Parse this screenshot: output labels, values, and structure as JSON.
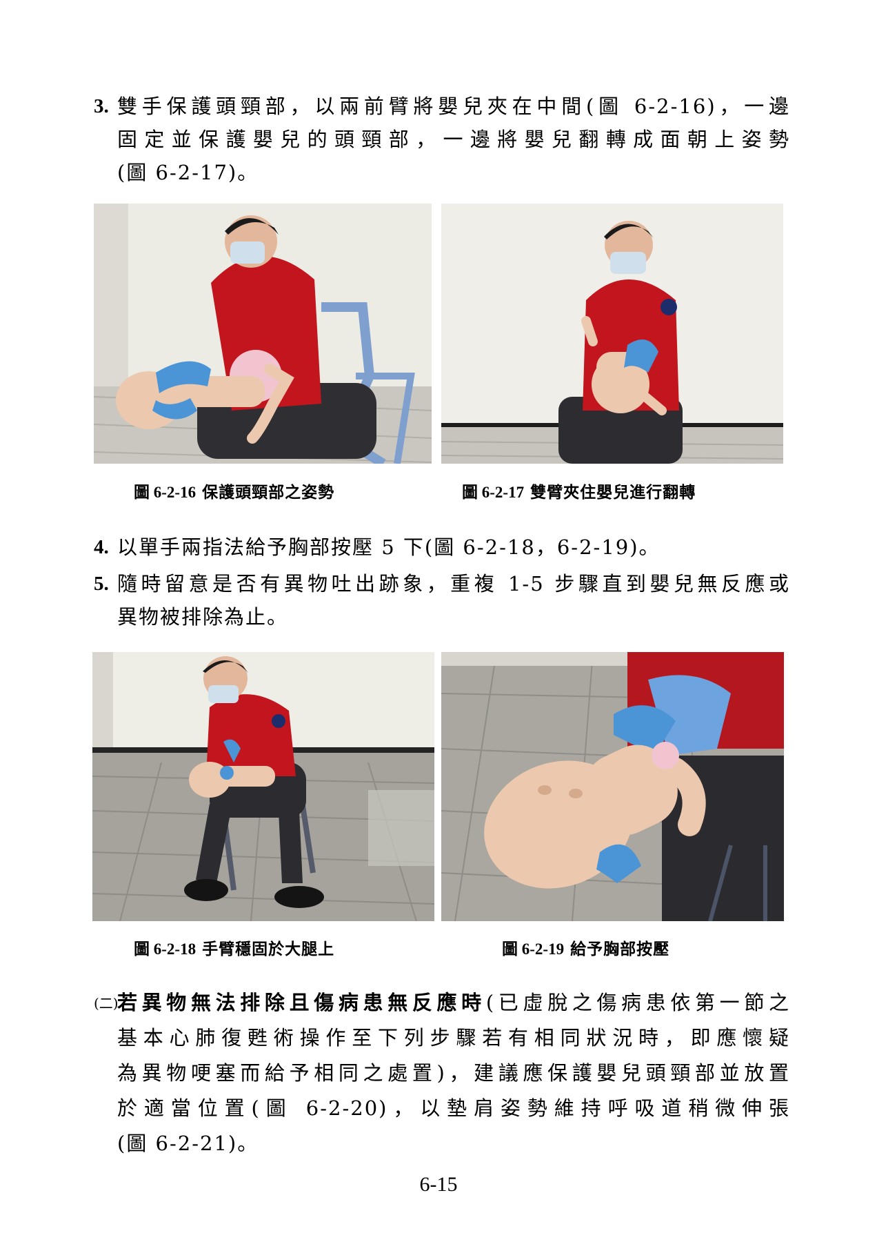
{
  "step3": {
    "num": "3.",
    "lines": [
      "雙手保護頭頸部，以兩前臂將嬰兒夾在中間(圖 6-2-16)，一邊",
      "固定並保護嬰兒的頭頸部，一邊將嬰兒翻轉成面朝上姿勢",
      "(圖 6-2-17)。"
    ]
  },
  "figures_top": [
    {
      "number": "圖 6-2-16",
      "caption": "保護頭頸部之姿勢"
    },
    {
      "number": "圖 6-2-17",
      "caption": "雙臂夾住嬰兒進行翻轉"
    }
  ],
  "step4": {
    "num": "4.",
    "text": "以單手兩指法給予胸部按壓 5 下(圖 6-2-18，6-2-19)。"
  },
  "step5": {
    "num": "5.",
    "lines": [
      "隨時留意是否有異物吐出跡象，重複 1-5 步驟直到嬰兒無反應或",
      "異物被排除為止。"
    ]
  },
  "figures_bottom": [
    {
      "number": "圖 6-2-18",
      "caption": "手臂穩固於大腿上"
    },
    {
      "number": "圖 6-2-19",
      "caption": "給予胸部按壓"
    }
  ],
  "section2": {
    "mark": "(二)",
    "bold_lead": "若異物無法排除且傷病患無反應時",
    "line1_rest": "(已虛脫之傷病患依第一節之",
    "lines": [
      "基本心肺復甦術操作至下列步驟若有相同狀況時，即應懷疑",
      "為異物哽塞而給予相同之處置)，建議應保護嬰兒頭頸部並放置",
      "於適當位置(圖 6-2-20)，以墊肩姿勢維持呼吸道稍微伸張",
      "(圖 6-2-21)。"
    ]
  },
  "page_number": "6-15"
}
